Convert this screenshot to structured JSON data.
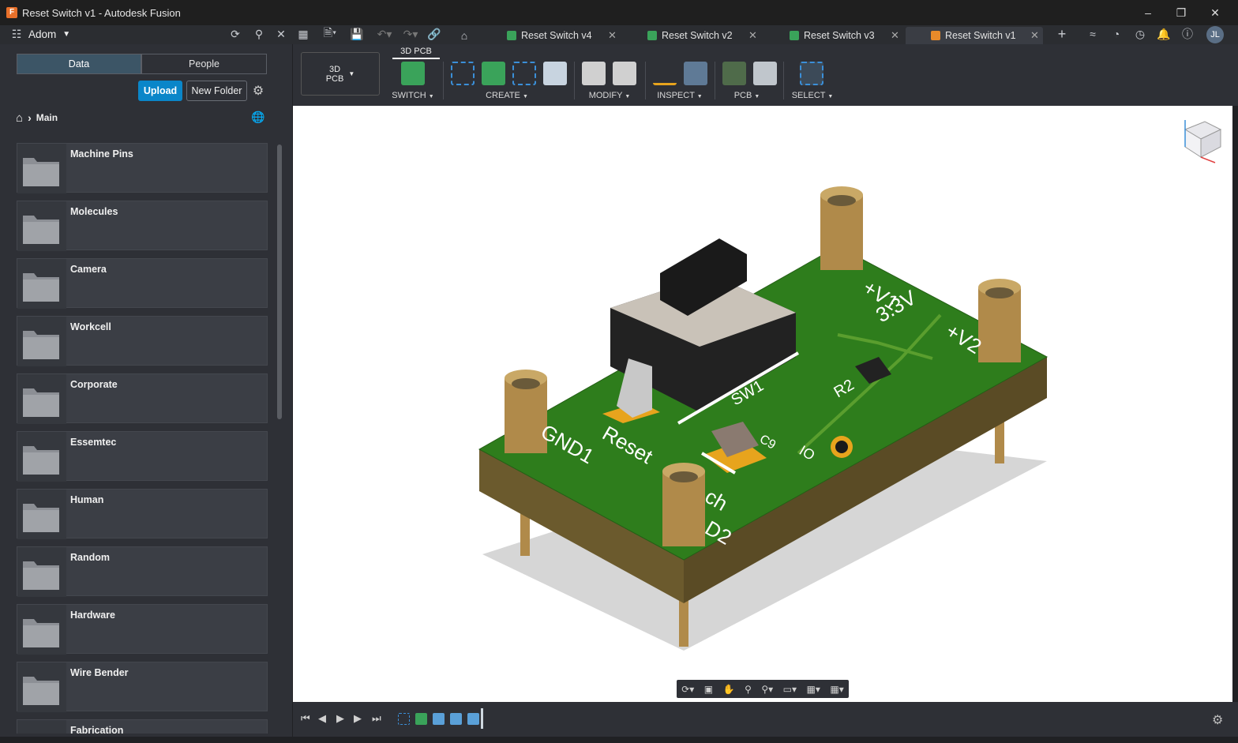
{
  "window": {
    "title": "Reset Switch v1 - Autodesk Fusion",
    "app_icon": "fusion-icon"
  },
  "toolbar": {
    "team_name": "Adom",
    "icons": [
      "refresh-icon",
      "search-icon",
      "close-icon",
      "grid-icon",
      "file-icon",
      "save-icon",
      "undo-icon",
      "redo-icon",
      "link-icon",
      "home-icon"
    ]
  },
  "tabs": [
    {
      "label": "Reset Switch v4",
      "color": "#3aa35a"
    },
    {
      "label": "Reset Switch v2",
      "color": "#3aa35a"
    },
    {
      "label": "Reset Switch v3",
      "color": "#3aa35a"
    },
    {
      "label": "Reset Switch v1",
      "color": "#e88a2a",
      "active": true
    }
  ],
  "user": {
    "initials": "JL"
  },
  "data_panel": {
    "segments": {
      "data": "Data",
      "people": "People"
    },
    "upload_label": "Upload",
    "new_folder_label": "New Folder",
    "breadcrumb": "Main",
    "folders": [
      "Machine Pins",
      "Molecules",
      "Camera",
      "Workcell",
      "Corporate",
      "Essemtec",
      "Human",
      "Random",
      "Hardware",
      "Wire Bender",
      "Fabrication"
    ]
  },
  "ribbon": {
    "workspace": {
      "line1": "3D",
      "line2": "PCB"
    },
    "active_tab": "3D PCB",
    "groups": [
      "SWITCH",
      "CREATE",
      "MODIFY",
      "INSPECT",
      "PCB",
      "SELECT"
    ]
  },
  "board": {
    "silkscreen": [
      "+V1",
      "3.3V",
      "+V2",
      "SW1",
      "R2",
      "GND1",
      "Reset",
      "ch",
      "D2",
      "IO",
      "C9"
    ],
    "colors": {
      "pcb": "#2e7d1c",
      "pad": "#e7a41d",
      "standoff": "#b08a4a",
      "switch": "#1e1e1e"
    }
  }
}
